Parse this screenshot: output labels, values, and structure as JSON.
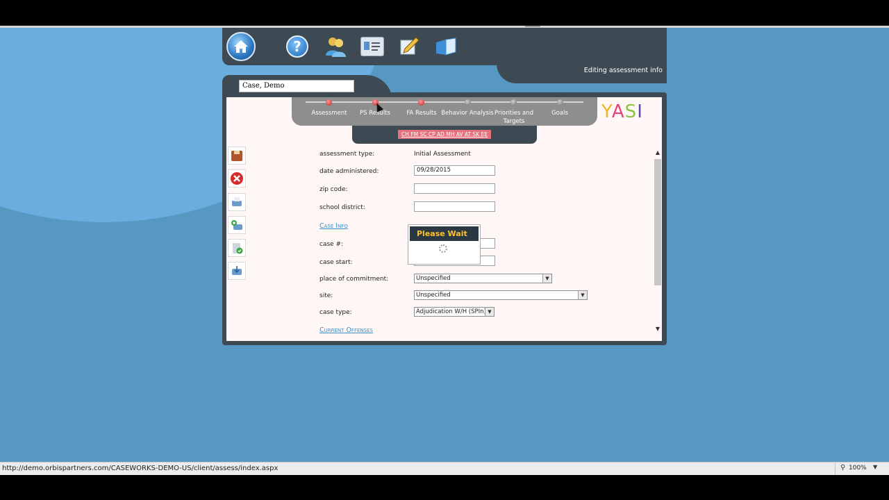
{
  "browser": {
    "status_url": "http://demo.orbispartners.com/CASEWORKS-DEMO-US/client/assess/index.aspx",
    "zoom": "100%"
  },
  "header": {
    "status_text": "Editing assessment info",
    "icons": [
      "home-icon",
      "help-icon",
      "people-icon",
      "id-card-icon",
      "edit-icon",
      "book-icon"
    ],
    "help_glyph": "?"
  },
  "client": {
    "name": "Case, Demo"
  },
  "steps": [
    {
      "label": "Assessment",
      "state": "red"
    },
    {
      "label": "PS Results",
      "state": "red"
    },
    {
      "label": "FA Results",
      "state": "red"
    },
    {
      "label": "Behavior Analysis",
      "state": "gray"
    },
    {
      "label": "Priorities and Targets",
      "state": "gray"
    },
    {
      "label": "Goals",
      "state": "gray"
    }
  ],
  "section_codes": "CH FM SC CP AD MH AV AT SK EE",
  "logo": {
    "y": "Y",
    "a": "A",
    "s": "S",
    "i": "I",
    "colors": [
      "#f0b323",
      "#e6407b",
      "#8cc33f",
      "#5b4aa8"
    ]
  },
  "side_tools": [
    "save-icon",
    "cancel-icon",
    "print-icon",
    "add-print-icon",
    "clipboard-check-icon",
    "export-icon"
  ],
  "form": {
    "assessment_type": {
      "label": "assessment type:",
      "value": "Initial Assessment"
    },
    "date_administered": {
      "label": "date administered:",
      "value": "09/28/2015"
    },
    "zip_code": {
      "label": "zip code:",
      "value": ""
    },
    "school_district": {
      "label": "school district:",
      "value": ""
    },
    "case_info_link": "Case Info",
    "case_number": {
      "label": "case #:",
      "value": ""
    },
    "case_start": {
      "label": "case start:",
      "value": ""
    },
    "place_of_commitment": {
      "label": "place of commitment:",
      "value": "Unspecified"
    },
    "site": {
      "label": "site:",
      "value": "Unspecified"
    },
    "case_type": {
      "label": "case type:",
      "value": "Adjudication W/H (SPIn)"
    },
    "current_offenses_link": "Current Offenses"
  },
  "dialog": {
    "title": "Please Wait"
  }
}
